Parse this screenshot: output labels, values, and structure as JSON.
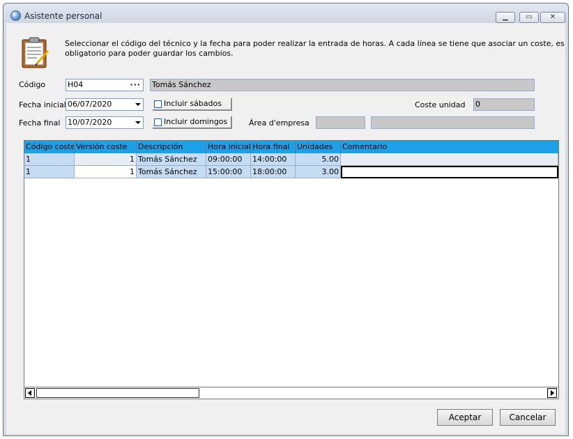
{
  "window": {
    "title": "Asistente personal"
  },
  "intro": {
    "line1": "Seleccionar el código del técnico y la fecha para poder realizar la entrada de horas. A cada línea se tiene que asociar un coste, es",
    "line2": "obligatorio para poder guardar los cambios."
  },
  "form": {
    "codigo_label": "Código",
    "codigo_value": "H04",
    "codigo_name": "Tomás Sánchez",
    "fecha_inicial_label": "Fecha inicial",
    "fecha_inicial_value": "06/07/2020",
    "fecha_final_label": "Fecha final",
    "fecha_final_value": "10/07/2020",
    "incluir_sabados_label": "Incluir sábados",
    "incluir_sabados_checked": false,
    "incluir_domingos_label": "Incluir domingos",
    "incluir_domingos_checked": false,
    "coste_unidad_label": "Coste unidad",
    "coste_unidad_value": "0",
    "area_empresa_label": "Área d'empresa",
    "area_empresa_code": "",
    "area_empresa_name": ""
  },
  "grid": {
    "columns": [
      "Código coste",
      "Versión coste",
      "Descripción",
      "Hora inicial",
      "Hora final",
      "Unidades",
      "Comentario"
    ],
    "rows": [
      {
        "codigo_coste": "1",
        "version_coste": "1",
        "descripcion": "Tomás Sánchez",
        "hora_inicial": "09:00:00",
        "hora_final": "14:00:00",
        "unidades": "5.00",
        "comentario": ""
      },
      {
        "codigo_coste": "1",
        "version_coste": "1",
        "descripcion": "Tomás Sánchez",
        "hora_inicial": "15:00:00",
        "hora_final": "18:00:00",
        "unidades": "3.00",
        "comentario": ""
      }
    ]
  },
  "buttons": {
    "aceptar": "Aceptar",
    "cancelar": "Cancelar"
  },
  "colors": {
    "grid_header": "#1ea0e6",
    "readonly_field": "#c8c8c8",
    "client_bg": "#f0f0f0"
  }
}
